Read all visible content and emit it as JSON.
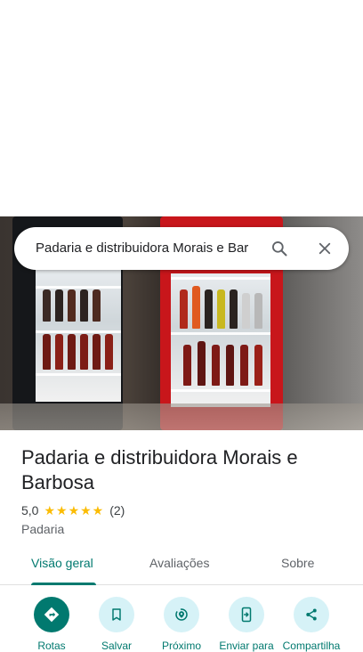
{
  "search": {
    "query": "Padaria e distribuidora Morais e Bar"
  },
  "place": {
    "name": "Padaria e distribuidora Morais e Barbosa",
    "rating": "5,0",
    "stars": "★★★★★",
    "review_count": "(2)",
    "category": "Padaria"
  },
  "tabs": [
    {
      "label": "Visão geral",
      "active": true
    },
    {
      "label": "Avaliações",
      "active": false
    },
    {
      "label": "Sobre",
      "active": false
    }
  ],
  "actions": [
    {
      "label": "Rotas",
      "icon": "directions-icon"
    },
    {
      "label": "Salvar",
      "icon": "bookmark-icon"
    },
    {
      "label": "Próximo",
      "icon": "nearby-icon"
    },
    {
      "label": "Enviar para",
      "icon": "send-to-phone-icon"
    },
    {
      "label": "Compartilha",
      "icon": "share-icon"
    }
  ],
  "colors": {
    "accent": "#01796f",
    "action_bg": "#d6f2f7",
    "star": "#fbbc04"
  }
}
